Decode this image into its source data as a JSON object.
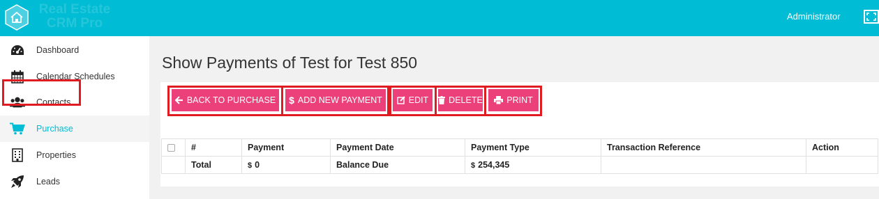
{
  "app": {
    "brand_line1": "Real Estate",
    "brand_line2": "CRM Pro",
    "user": "Administrator"
  },
  "colors": {
    "topbar": "#00bcd4",
    "accent": "#00bcd4",
    "button": "#ec407a",
    "highlight": "#e11b22"
  },
  "sidebar": {
    "items": [
      {
        "label": "Dashboard",
        "icon": "dashboard-icon"
      },
      {
        "label": "Calendar Schedules",
        "icon": "calendar-icon"
      },
      {
        "label": "Contacts",
        "icon": "users-icon"
      },
      {
        "label": "Purchase",
        "icon": "shopping-cart-icon",
        "active": true
      },
      {
        "label": "Properties",
        "icon": "building-icon"
      },
      {
        "label": "Leads",
        "icon": "rocket-icon"
      }
    ]
  },
  "page": {
    "title": "Show Payments of Test for Test 850"
  },
  "toolbar": {
    "back_label": "BACK TO PURCHASE",
    "add_label": "ADD NEW PAYMENT",
    "edit_label": "EDIT",
    "delete_label": "DELETE",
    "print_label": "PRINT"
  },
  "table": {
    "headers": [
      "#",
      "Payment",
      "Payment Date",
      "Payment Type",
      "Transaction Reference",
      "Action"
    ],
    "total_row": {
      "label": "Total",
      "currency": "$",
      "payment": "0",
      "date_label": "Balance Due",
      "balance": "254,345"
    }
  }
}
